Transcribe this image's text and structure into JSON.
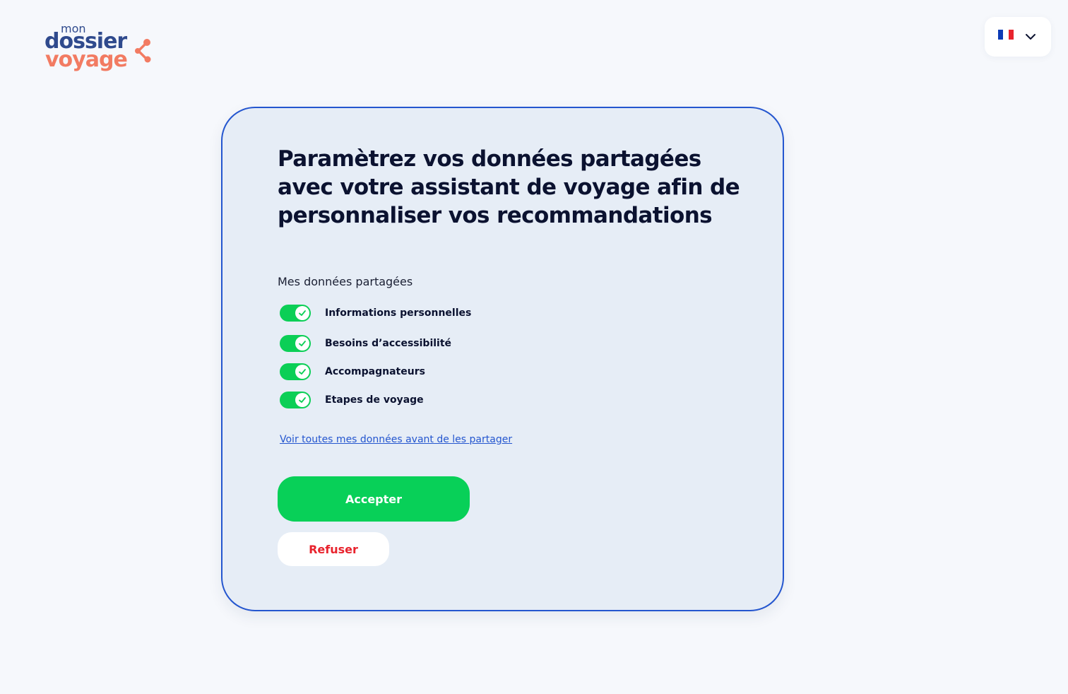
{
  "logo": {
    "mon": "mon",
    "dossier": "dossier",
    "voyage": "voyage"
  },
  "language": {
    "selected": "fr",
    "flag_colors": [
      "#0d3bb5",
      "#ffffff",
      "#e8232d"
    ]
  },
  "card": {
    "title": "Paramètrez vos données partagées avec votre assistant de voyage afin de personnaliser vos recommandations",
    "section_label": "Mes données partagées",
    "toggles": [
      {
        "label": "Informations personnelles",
        "checked": true
      },
      {
        "label": "Besoins d’accessibilité",
        "checked": true
      },
      {
        "label": "Accompagnateurs",
        "checked": true
      },
      {
        "label": "Etapes de voyage",
        "checked": true
      }
    ],
    "view_link": "Voir toutes mes données avant de les partager",
    "accept_label": "Accepter",
    "refuse_label": "Refuser"
  },
  "colors": {
    "accent_blue": "#2456cf",
    "toggle_green": "#0bcf56",
    "accept_green": "#08d058",
    "refuse_red": "#e8232d",
    "logo_blue": "#2f4a8d",
    "logo_orange": "#f27b62"
  }
}
